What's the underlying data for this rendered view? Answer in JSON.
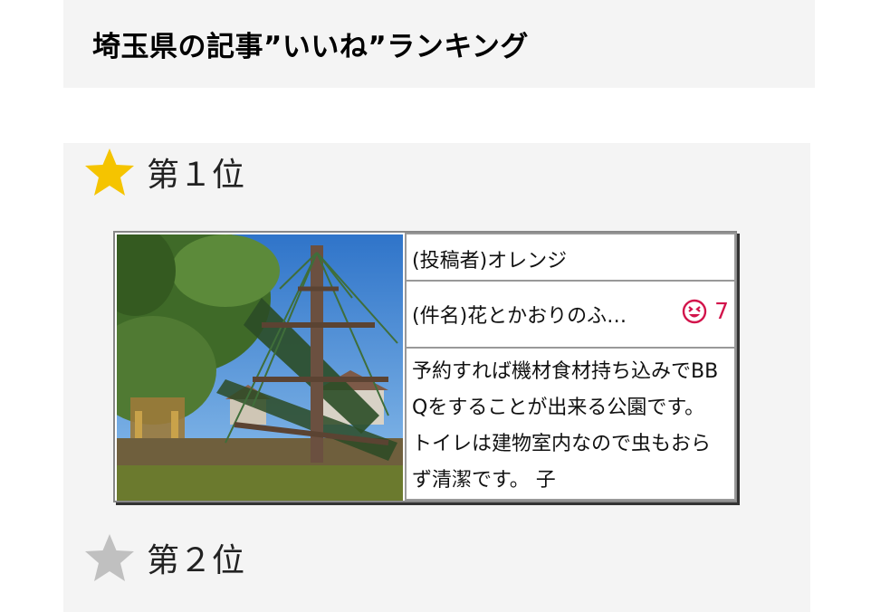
{
  "header": {
    "title": "埼玉県の記事”いいね”ランキング"
  },
  "ranking": {
    "items": [
      {
        "rank_label": "第１位",
        "star_icon": "gold-star-icon",
        "star_color": "#f5c400",
        "author": "(投稿者)オレンジ",
        "title": "(件名)花とかおりのふ…",
        "like_icon": "laughing-face-icon",
        "like_color": "#d2144b",
        "likes": "7",
        "body": "予約すれば機材食材持ち込みでBBQをすることが出来る公園です。 トイレは建物室内なので虫もおらず清潔です。 子"
      },
      {
        "rank_label": "第２位",
        "star_icon": "silver-star-icon",
        "star_color": "#c0c0c0"
      }
    ]
  }
}
